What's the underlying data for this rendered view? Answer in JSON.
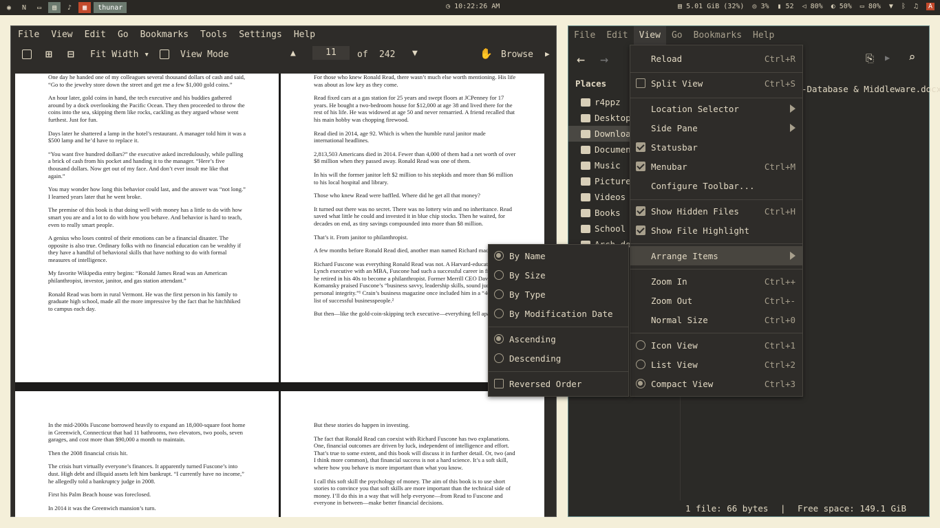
{
  "topbar": {
    "workspaces": [
      "N",
      "thunar"
    ],
    "clock": "10:22:26 AM",
    "memory": "5.01 GiB (32%)",
    "cpu": "3%",
    "temp": "52",
    "volume": "80%",
    "brightness": "50%",
    "battery": "80%",
    "launcher": "A"
  },
  "reader": {
    "menu": [
      "File",
      "View",
      "Edit",
      "Go",
      "Bookmarks",
      "Tools",
      "Settings",
      "Help"
    ],
    "toolbar": {
      "zoom_mode": "Fit Width",
      "view_mode": "View Mode",
      "current_page": "11",
      "of_label": "of",
      "total_pages": "242",
      "browse": "Browse"
    },
    "page1": [
      "One day he handed one of my colleagues several thousand dollars of cash and said, “Go to the jewelry store down the street and get me a few $1,000 gold coins.”",
      "An hour later, gold coins in hand, the tech executive and his buddies gathered around by a dock overlooking the Pacific Ocean. They then proceeded to throw the coins into the sea, skipping them like rocks, cackling as they argued whose went furthest. Just for fun.",
      "Days later he shattered a lamp in the hotel’s restaurant. A manager told him it was a $500 lamp and he’d have to replace it.",
      "“You want five hundred dollars?” the executive asked incredulously, while pulling a brick of cash from his pocket and handing it to the manager. “Here’s five thousand dollars. Now get out of my face. And don’t ever insult me like that again.”",
      "You may wonder how long this behavior could last, and the answer was “not long.” I learned years later that he went broke.",
      "The premise of this book is that doing well with money has a little to do with how smart you are and a lot to do with how you behave. And behavior is hard to teach, even to really smart people.",
      "A genius who loses control of their emotions can be a financial disaster. The opposite is also true. Ordinary folks with no financial education can be wealthy if they have a handful of behavioral skills that have nothing to do with formal measures of intelligence.",
      "My favorite Wikipedia entry begins: “Ronald James Read was an American philanthropist, investor, janitor, and gas station attendant.”",
      "Ronald Read was born in rural Vermont. He was the first person in his family to graduate high school, made all the more impressive by the fact that he hitchhiked to campus each day."
    ],
    "page2": [
      "For those who knew Ronald Read, there wasn’t much else worth mentioning. His life was about as low key as they come.",
      "Read fixed cars at a gas station for 25 years and swept floors at JCPenney for 17 years. He bought a two-bedroom house for $12,000 at age 38 and lived there for the rest of his life. He was widowed at age 50 and never remarried. A friend recalled that his main hobby was chopping firewood.",
      "Read died in 2014, age 92. Which is when the humble rural janitor made international headlines.",
      "2,813,503 Americans died in 2014. Fewer than 4,000 of them had a net worth of over $8 million when they passed away. Ronald Read was one of them.",
      "In his will the former janitor left $2 million to his stepkids and more than $6 million to his local hospital and library.",
      "Those who knew Read were baffled. Where did he get all that money?",
      "It turned out there was no secret. There was no lottery win and no inheritance. Read saved what little he could and invested it in blue chip stocks. Then he waited, for decades on end, as tiny savings compounded into more than $8 million.",
      "That’s it. From janitor to philanthropist.",
      "A few months before Ronald Read died, another man named Richard made the news.",
      "Richard Fuscone was everything Ronald Read was not. A Harvard-educated Merrill Lynch executive with an MBA, Fuscone had such a successful career in finance that he retired in his 40s to become a philanthropist. Former Merrill CEO David Komansky praised Fuscone’s “business savvy, leadership skills, sound judgment and personal integrity.”¹ Crain’s business magazine once included him in a “40 under 40” list of successful businesspeople.²",
      "But then—like the gold-coin-skipping tech executive—everything fell apart."
    ],
    "page3": [
      "In the mid-2000s Fuscone borrowed heavily to expand an 18,000-square foot home in Greenwich, Connecticut that had 11 bathrooms, two elevators, two pools, seven garages, and cost more than $90,000 a month to maintain.",
      "Then the 2008 financial crisis hit.",
      "The crisis hurt virtually everyone’s finances. It apparently turned Fuscone’s into dust. High debt and illiquid assets left him bankrupt. “I currently have no income,” he allegedly told a bankruptcy judge in 2008.",
      "First his Palm Beach house was foreclosed.",
      "In 2014 it was the Greenwich mansion’s turn."
    ],
    "page4": [
      "But these stories do happen in investing.",
      "The fact that Ronald Read can coexist with Richard Fuscone has two explanations. One, financial outcomes are driven by luck, independent of intelligence and effort. That’s true to some extent, and this book will discuss it in further detail. Or, two (and I think more common), that financial success is not a hard science. It’s a soft skill, where how you behave is more important than what you know.",
      "I call this soft skill the psychology of money. The aim of this book is to use short stories to convince you that soft skills are more important than the technical side of money. I’ll do this in a way that will help everyone—from Read to Fuscone and everyone in between—make better financial decisions."
    ]
  },
  "thunar": {
    "menu": [
      "File",
      "Edit",
      "View",
      "Go",
      "Bookmarks",
      "Help"
    ],
    "places_header": "Places",
    "places": [
      "r4ppz",
      "Desktop",
      "Downloads",
      "Documents",
      "Music",
      "Pictures",
      "Videos",
      "Books",
      "School",
      "Arch-dotfiles"
    ],
    "file_name": "-Database & Middleware.docx",
    "status_files": "1 file: 66 bytes",
    "status_sep": "|",
    "status_free": "Free space: 149.1 GiB"
  },
  "view_menu": [
    {
      "label": "Reload",
      "shortcut": "Ctrl+R"
    },
    {
      "label": "Split View",
      "shortcut": "Ctrl+S"
    },
    {
      "label": "Location Selector",
      "shortcut": ""
    },
    {
      "label": "Side Pane",
      "shortcut": ""
    },
    {
      "label": "Statusbar",
      "shortcut": ""
    },
    {
      "label": "Menubar",
      "shortcut": "Ctrl+M"
    },
    {
      "label": "Configure Toolbar...",
      "shortcut": ""
    },
    {
      "label": "Show Hidden Files",
      "shortcut": "Ctrl+H"
    },
    {
      "label": "Show File Highlight",
      "shortcut": ""
    },
    {
      "label": "Arrange Items",
      "shortcut": ""
    },
    {
      "label": "Zoom In",
      "shortcut": "Ctrl++"
    },
    {
      "label": "Zoom Out",
      "shortcut": "Ctrl+-"
    },
    {
      "label": "Normal Size",
      "shortcut": "Ctrl+0"
    },
    {
      "label": "Icon View",
      "shortcut": "Ctrl+1"
    },
    {
      "label": "List View",
      "shortcut": "Ctrl+2"
    },
    {
      "label": "Compact View",
      "shortcut": "Ctrl+3"
    }
  ],
  "arrange_menu": [
    "By Name",
    "By Size",
    "By Type",
    "By Modification Date",
    "Ascending",
    "Descending",
    "Reversed Order"
  ],
  "colors": {
    "accent": "#6b9090",
    "highlight": "#c34a2c",
    "panel": "#2e2c29"
  }
}
